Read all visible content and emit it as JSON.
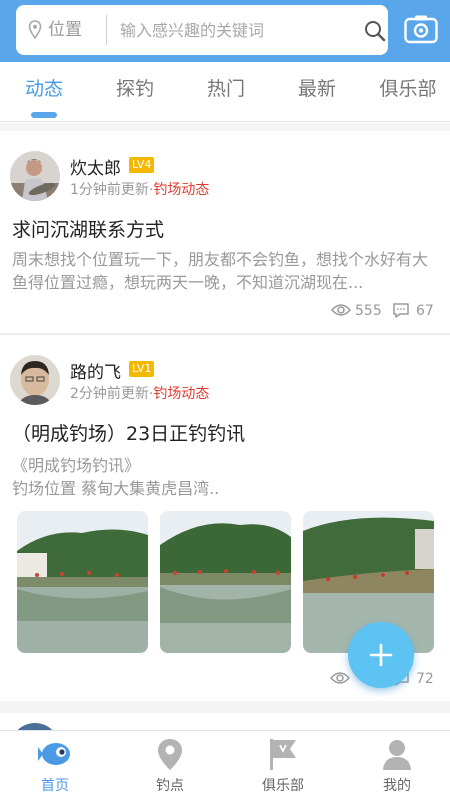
{
  "search": {
    "location_label": "位置",
    "placeholder": "输入感兴趣的关键词"
  },
  "tabs": [
    {
      "label": "动态"
    },
    {
      "label": "探钓"
    },
    {
      "label": "热门"
    },
    {
      "label": "最新"
    },
    {
      "label": "俱乐部"
    }
  ],
  "posts": [
    {
      "author": "炊太郎",
      "level": "LV4",
      "time": "1分钟前更新·",
      "category": "钓场动态",
      "title": "求问沉湖联系方式",
      "body": "周末想找个位置玩一下，朋友都不会钓鱼，想找个水好有大鱼得位置过瘾，想玩两天一晚，不知道沉湖现在...",
      "views": "555",
      "comments": "67"
    },
    {
      "author": "路的飞",
      "level": "LV1",
      "time": "2分钟前更新·",
      "category": "钓场动态",
      "title": "（明成钓场）23日正钓钓讯",
      "body_line1": "《明成钓场钓讯》",
      "body_line2": "钓场位置 蔡甸大集黄虎昌湾..",
      "comments": "72"
    }
  ],
  "bottom_nav": [
    {
      "label": "首页",
      "icon": "fish-home-icon"
    },
    {
      "label": "钓点",
      "icon": "map-pin-icon"
    },
    {
      "label": "俱乐部",
      "icon": "flag-icon"
    },
    {
      "label": "我的",
      "icon": "user-icon"
    }
  ],
  "colors": {
    "header": "#5aa6ea",
    "accent": "#4a9ae6",
    "category": "#e23b2f",
    "badge": "#f5b800",
    "fab": "#5cc3f3"
  }
}
